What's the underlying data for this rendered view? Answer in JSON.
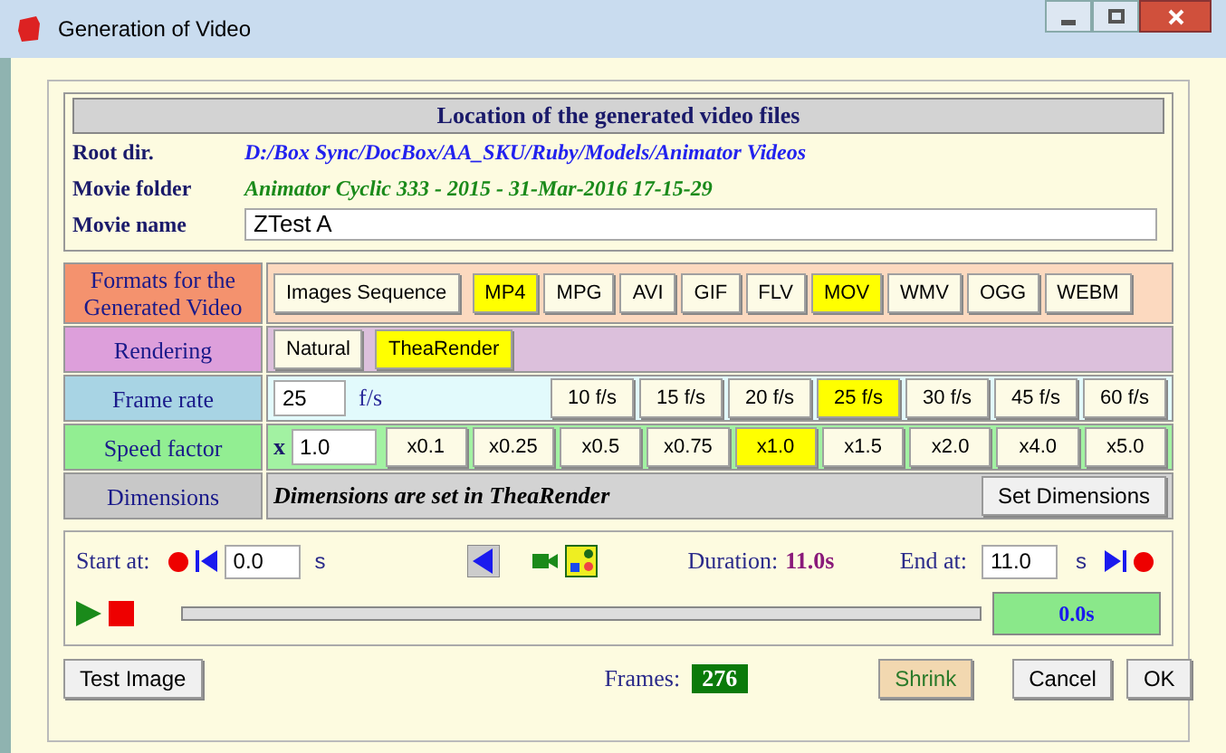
{
  "window": {
    "title": "Generation of Video"
  },
  "location": {
    "title": "Location of the generated video files",
    "fields": [
      {
        "label": "Root dir.",
        "kind": "path",
        "value": "D:/Box Sync/DocBox/AA_SKU/Ruby/Models/Animator Videos"
      },
      {
        "label": "Movie folder",
        "kind": "folder",
        "value": "Animator Cyclic 333 - 2015 - 31-Mar-2016 17-15-29"
      },
      {
        "label": "Movie name",
        "kind": "input",
        "value": "ZTest A"
      }
    ]
  },
  "formats": {
    "label": "Formats for the Generated Video",
    "options": [
      {
        "label": "Images Sequence",
        "selected": false
      },
      {
        "label": "MP4",
        "selected": true
      },
      {
        "label": "MPG",
        "selected": false
      },
      {
        "label": "AVI",
        "selected": false
      },
      {
        "label": "GIF",
        "selected": false
      },
      {
        "label": "FLV",
        "selected": false
      },
      {
        "label": "MOV",
        "selected": true
      },
      {
        "label": "WMV",
        "selected": false
      },
      {
        "label": "OGG",
        "selected": false
      },
      {
        "label": "WEBM",
        "selected": false
      }
    ]
  },
  "rendering": {
    "label": "Rendering",
    "options": [
      {
        "label": "Natural",
        "selected": false
      },
      {
        "label": "TheaRender",
        "selected": true
      }
    ]
  },
  "frame_rate": {
    "label": "Frame rate",
    "value": "25",
    "unit": "f/s",
    "options": [
      {
        "label": "10 f/s",
        "selected": false
      },
      {
        "label": "15 f/s",
        "selected": false
      },
      {
        "label": "20 f/s",
        "selected": false
      },
      {
        "label": "25 f/s",
        "selected": true
      },
      {
        "label": "30 f/s",
        "selected": false
      },
      {
        "label": "45 f/s",
        "selected": false
      },
      {
        "label": "60 f/s",
        "selected": false
      }
    ]
  },
  "speed": {
    "label": "Speed factor",
    "prefix": "x",
    "value": "1.0",
    "options": [
      {
        "label": "x0.1",
        "selected": false
      },
      {
        "label": "x0.25",
        "selected": false
      },
      {
        "label": "x0.5",
        "selected": false
      },
      {
        "label": "x0.75",
        "selected": false
      },
      {
        "label": "x1.0",
        "selected": true
      },
      {
        "label": "x1.5",
        "selected": false
      },
      {
        "label": "x2.0",
        "selected": false
      },
      {
        "label": "x4.0",
        "selected": false
      },
      {
        "label": "x5.0",
        "selected": false
      }
    ]
  },
  "dimensions": {
    "label": "Dimensions",
    "note": "Dimensions are set in TheaRender",
    "button": "Set Dimensions"
  },
  "playback": {
    "start_label": "Start at:",
    "start_value": "0.0",
    "start_unit": "s",
    "duration_label": "Duration:",
    "duration_value": "11.0s",
    "end_label": "End at:",
    "end_value": "11.0",
    "end_unit": "s",
    "level": 0,
    "time": "0.0s"
  },
  "footer": {
    "test_button": "Test Image",
    "frames_label": "Frames:",
    "frames_value": "276",
    "shrink_button": "Shrink",
    "cancel_button": "Cancel",
    "ok_button": "OK"
  }
}
